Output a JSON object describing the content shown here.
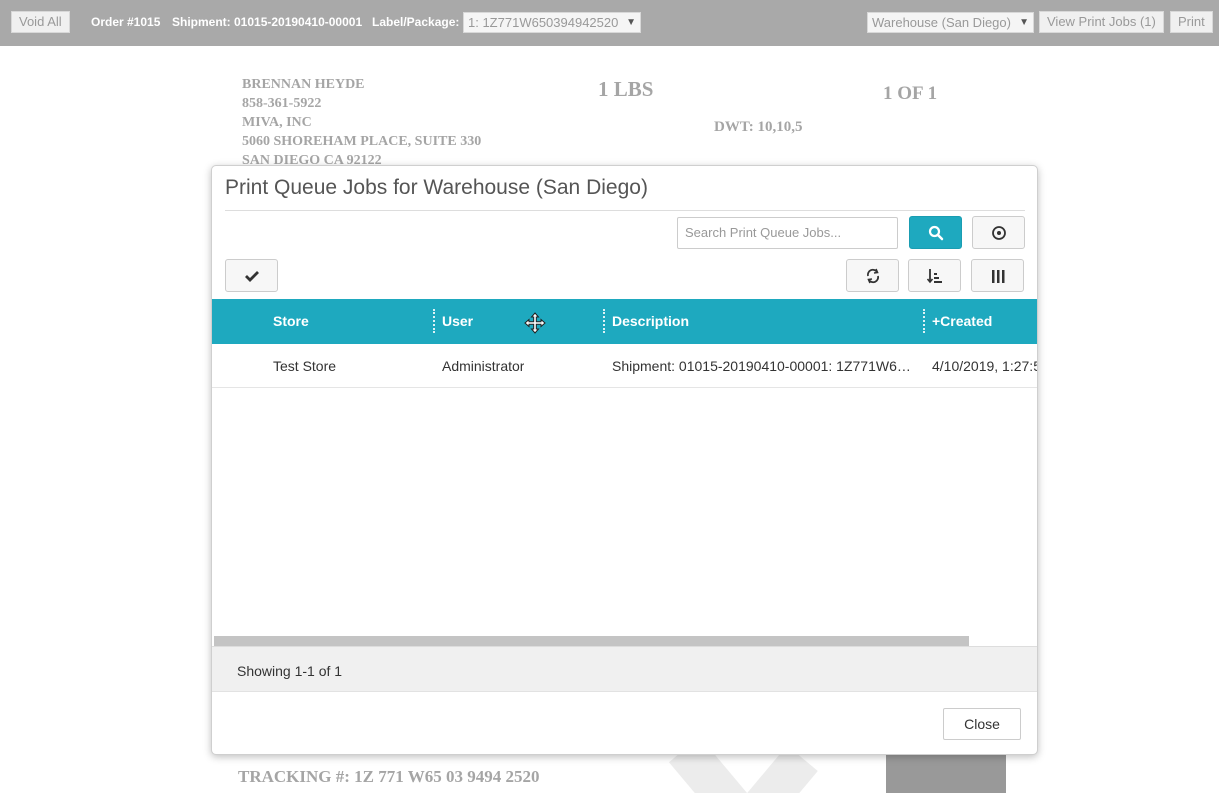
{
  "toolbar": {
    "void_all": "Void All",
    "order": "Order #1015",
    "shipment": "Shipment: 01015-20190410-00001",
    "label_package_label": "Label/Package:",
    "label_package_value": "1: 1Z771W650394942520",
    "warehouse_value": "Warehouse (San Diego)",
    "view_print_jobs": "View Print Jobs (1)",
    "print": "Print"
  },
  "label": {
    "address": [
      "BRENNAN HEYDE",
      "858-361-5922",
      "MIVA, INC",
      "5060 SHOREHAM PLACE, SUITE 330",
      "SAN DIEGO CA 92122"
    ],
    "weight": "1 LBS",
    "package_count": "1 OF 1",
    "dwt": "DWT: 10,10,5",
    "tracking": "TRACKING #: 1Z 771 W65 03 9494 2520"
  },
  "modal": {
    "title": "Print Queue Jobs for Warehouse (San Diego)",
    "search_placeholder": "Search Print Queue Jobs...",
    "columns": [
      "Store",
      "User",
      "Description",
      "+Created"
    ],
    "rows": [
      {
        "store": "Test Store",
        "user": "Administrator",
        "description": "Shipment: 01015-20190410-00001: 1Z771W6…",
        "created": "4/10/2019, 1:27:5"
      }
    ],
    "footer_text": "Showing 1-1 of 1",
    "close_label": "Close"
  },
  "colors": {
    "accent": "#1ea9bf",
    "toolbar_bg": "#a9a9a9"
  }
}
